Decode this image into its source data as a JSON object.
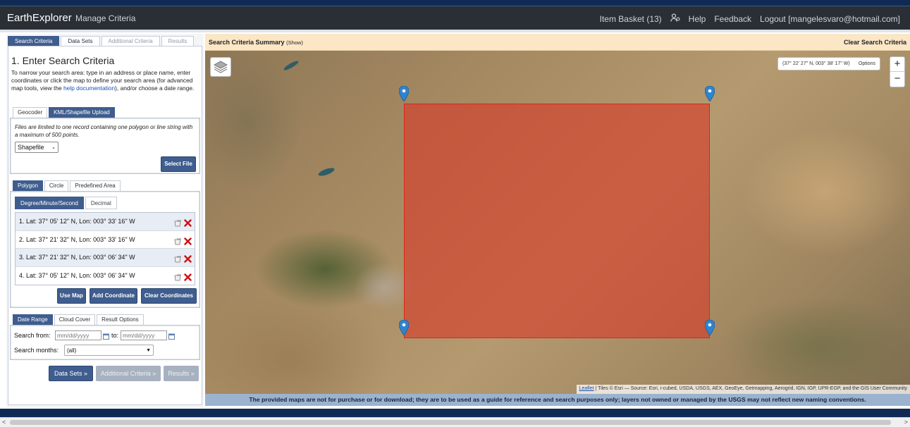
{
  "navbar": {
    "brand": "EarthExplorer",
    "manage_criteria": "Manage Criteria",
    "item_basket": "Item Basket (13)",
    "help": "Help",
    "feedback": "Feedback",
    "logout": "Logout [mangelesvaro@hotmail.com]"
  },
  "main_tabs": [
    "Search Criteria",
    "Data Sets",
    "Additional Criteria",
    "Results"
  ],
  "criteria": {
    "heading": "1. Enter Search Criteria",
    "intro_before_link": "To narrow your search area: type in an address or place name, enter coordinates or click the map to define your search area (for advanced map tools, view the",
    "intro_link": "help documentation",
    "intro_after_link": "), and/or choose a date range."
  },
  "upload": {
    "tabs": [
      "Geocoder",
      "KML/Shapefile Upload"
    ],
    "note": "Files are limited to one record containing one polygon or line string with a maximum of 500 points.",
    "file_type": "Shapefile",
    "select_file": "Select File"
  },
  "shape": {
    "tabs": [
      "Polygon",
      "Circle",
      "Predefined Area"
    ],
    "format_tabs": [
      "Degree/Minute/Second",
      "Decimal"
    ],
    "coordinates": [
      "1.  Lat: 37° 05' 12\" N, Lon: 003° 33' 16\" W",
      "2.  Lat: 37° 21' 32\" N, Lon: 003° 33' 16\" W",
      "3.  Lat: 37° 21' 32\" N, Lon: 003° 06' 34\" W",
      "4.  Lat: 37° 05' 12\" N, Lon: 003° 06' 34\" W"
    ],
    "use_map": "Use Map",
    "add_coordinate": "Add Coordinate",
    "clear_coordinates": "Clear Coordinates"
  },
  "date": {
    "tabs": [
      "Date Range",
      "Cloud Cover",
      "Result Options"
    ],
    "search_from_label": "Search from:",
    "to_label": "to:",
    "placeholder": "mm/dd/yyyy",
    "months_label": "Search months:",
    "months_value": "(all)"
  },
  "bottom_buttons": [
    "Data Sets »",
    "Additional Criteria »",
    "Results »"
  ],
  "map": {
    "summary_title": "Search Criteria Summary",
    "summary_show": "(Show)",
    "clear_criteria": "Clear Search Criteria",
    "cursor_coords": "(37° 22' 27\" N, 003° 38' 17\" W)",
    "options": "Options",
    "zoom_in": "+",
    "zoom_out": "−",
    "attribution_link": "Leaflet",
    "attribution_text": "| Tiles © Esri — Source: Esri, i-cubed, USDA, USGS, AEX, GeoEye, Getmapping, Aerogrid, IGN, IGP, UPR-EGP, and the GIS User Community",
    "disclaimer": "The provided maps are not for purchase or for download; they are to be used as a guide for reference and search purposes only; layers not owned or managed by the USGS may not reflect new naming conventions."
  },
  "colors": {
    "nav_bg": "#2a2f36",
    "accent": "#3f5d8e",
    "polygon_fill": "#d63a28",
    "summary_bg": "#fbe7c6",
    "disclaimer_bg": "#9bb3cf"
  }
}
